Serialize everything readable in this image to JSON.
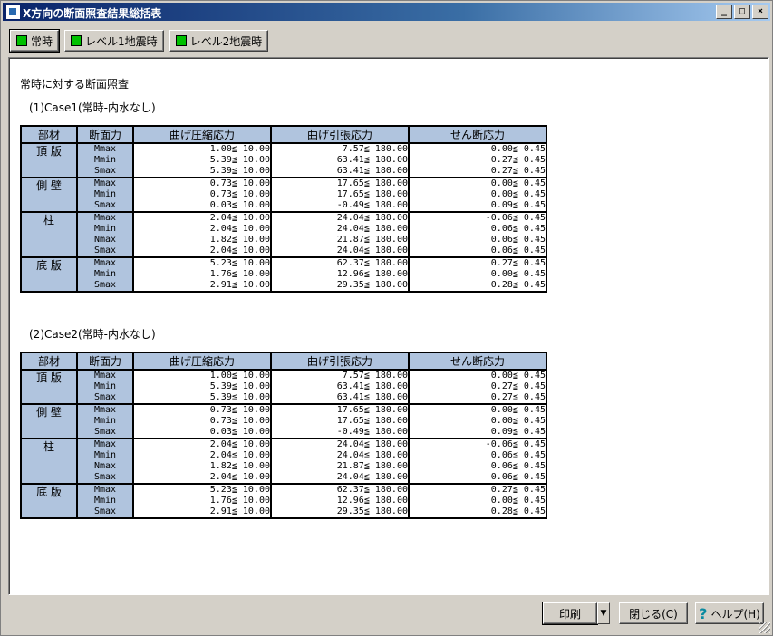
{
  "window": {
    "title": "X方向の断面照査結果総括表",
    "controls": [
      "_",
      "□",
      "×"
    ]
  },
  "modes": [
    {
      "label": "常時",
      "active": true
    },
    {
      "label": "レベル1地震時",
      "active": false
    },
    {
      "label": "レベル2地震時",
      "active": false
    }
  ],
  "report": {
    "heading": "常時に対する断面照査",
    "columns": [
      "部材",
      "断面力",
      "曲げ圧縮応力",
      "曲げ引張応力",
      "せん断応力"
    ],
    "cases": [
      {
        "title": "(1)Case1(常時-内水なし)",
        "groups": [
          {
            "member": "頂 版",
            "forces": [
              "Mmax",
              "Mmin",
              "Smax"
            ],
            "comp": [
              "1.00≦ 10.00",
              "5.39≦ 10.00",
              "5.39≦ 10.00"
            ],
            "tens": [
              "7.57≦ 180.00",
              "63.41≦ 180.00",
              "63.41≦ 180.00"
            ],
            "shear": [
              "0.00≦ 0.45",
              "0.27≦ 0.45",
              "0.27≦ 0.45"
            ]
          },
          {
            "member": "側 壁",
            "forces": [
              "Mmax",
              "Mmin",
              "Smax"
            ],
            "comp": [
              "0.73≦ 10.00",
              "0.73≦ 10.00",
              "0.03≦ 10.00"
            ],
            "tens": [
              "17.65≦ 180.00",
              "17.65≦ 180.00",
              "-0.49≦ 180.00"
            ],
            "shear": [
              "0.00≦ 0.45",
              "0.00≦ 0.45",
              "0.09≦ 0.45"
            ]
          },
          {
            "member": "柱",
            "forces": [
              "Mmax",
              "Mmin",
              "Nmax",
              "Smax"
            ],
            "comp": [
              "2.04≦ 10.00",
              "2.04≦ 10.00",
              "1.82≦ 10.00",
              "2.04≦ 10.00"
            ],
            "tens": [
              "24.04≦ 180.00",
              "24.04≦ 180.00",
              "21.87≦ 180.00",
              "24.04≦ 180.00"
            ],
            "shear": [
              "-0.06≦ 0.45",
              "0.06≦ 0.45",
              "0.06≦ 0.45",
              "0.06≦ 0.45"
            ]
          },
          {
            "member": "底 版",
            "forces": [
              "Mmax",
              "Mmin",
              "Smax"
            ],
            "comp": [
              "5.23≦ 10.00",
              "1.76≦ 10.00",
              "2.91≦ 10.00"
            ],
            "tens": [
              "62.37≦ 180.00",
              "12.96≦ 180.00",
              "29.35≦ 180.00"
            ],
            "shear": [
              "0.27≦ 0.45",
              "0.00≦ 0.45",
              "0.28≦ 0.45"
            ]
          }
        ]
      },
      {
        "title": "(2)Case2(常時-内水なし)",
        "groups": [
          {
            "member": "頂 版",
            "forces": [
              "Mmax",
              "Mmin",
              "Smax"
            ],
            "comp": [
              "1.00≦ 10.00",
              "5.39≦ 10.00",
              "5.39≦ 10.00"
            ],
            "tens": [
              "7.57≦ 180.00",
              "63.41≦ 180.00",
              "63.41≦ 180.00"
            ],
            "shear": [
              "0.00≦ 0.45",
              "0.27≦ 0.45",
              "0.27≦ 0.45"
            ]
          },
          {
            "member": "側 壁",
            "forces": [
              "Mmax",
              "Mmin",
              "Smax"
            ],
            "comp": [
              "0.73≦ 10.00",
              "0.73≦ 10.00",
              "0.03≦ 10.00"
            ],
            "tens": [
              "17.65≦ 180.00",
              "17.65≦ 180.00",
              "-0.49≦ 180.00"
            ],
            "shear": [
              "0.00≦ 0.45",
              "0.00≦ 0.45",
              "0.09≦ 0.45"
            ]
          },
          {
            "member": "柱",
            "forces": [
              "Mmax",
              "Mmin",
              "Nmax",
              "Smax"
            ],
            "comp": [
              "2.04≦ 10.00",
              "2.04≦ 10.00",
              "1.82≦ 10.00",
              "2.04≦ 10.00"
            ],
            "tens": [
              "24.04≦ 180.00",
              "24.04≦ 180.00",
              "21.87≦ 180.00",
              "24.04≦ 180.00"
            ],
            "shear": [
              "-0.06≦ 0.45",
              "0.06≦ 0.45",
              "0.06≦ 0.45",
              "0.06≦ 0.45"
            ]
          },
          {
            "member": "底 版",
            "forces": [
              "Mmax",
              "Mmin",
              "Smax"
            ],
            "comp": [
              "5.23≦ 10.00",
              "1.76≦ 10.00",
              "2.91≦ 10.00"
            ],
            "tens": [
              "62.37≦ 180.00",
              "12.96≦ 180.00",
              "29.35≦ 180.00"
            ],
            "shear": [
              "0.27≦ 0.45",
              "0.00≦ 0.45",
              "0.28≦ 0.45"
            ]
          }
        ]
      }
    ]
  },
  "footer": {
    "print_label": "印刷",
    "close_label": "閉じる(C)",
    "help_label": "ヘルプ(H)"
  },
  "colors": {
    "header_fill": "#b0c4de",
    "led": "#00c000",
    "title_bar": "#0a246a"
  }
}
